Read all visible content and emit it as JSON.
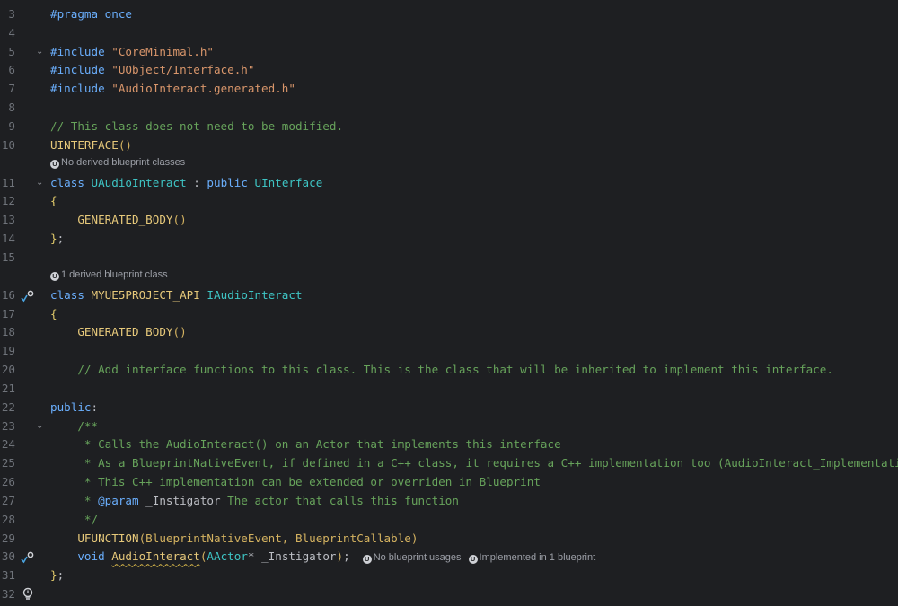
{
  "editor": {
    "lines": [
      {
        "n": "3",
        "segs": [
          {
            "t": "#pragma once",
            "c": "pp"
          }
        ]
      },
      {
        "n": "4",
        "segs": []
      },
      {
        "n": "5",
        "fold": "⌄",
        "segs": [
          {
            "t": "#include ",
            "c": "pp"
          },
          {
            "t": "\"CoreMinimal.h\"",
            "c": "str"
          }
        ]
      },
      {
        "n": "6",
        "segs": [
          {
            "t": "#include ",
            "c": "pp"
          },
          {
            "t": "\"UObject/Interface.h\"",
            "c": "str"
          }
        ]
      },
      {
        "n": "7",
        "segs": [
          {
            "t": "#include ",
            "c": "pp"
          },
          {
            "t": "\"AudioInteract.generated.h\"",
            "c": "str"
          }
        ]
      },
      {
        "n": "8",
        "segs": []
      },
      {
        "n": "9",
        "segs": [
          {
            "t": "// This class does not need to be modified.",
            "c": "cm"
          }
        ]
      },
      {
        "n": "10",
        "segs": [
          {
            "t": "UINTERFACE",
            "c": "mac"
          },
          {
            "t": "()",
            "c": "par"
          }
        ]
      },
      {
        "n": "11",
        "fold": "⌄",
        "segs": [
          {
            "t": "class ",
            "c": "kw"
          },
          {
            "t": "UAudioInteract",
            "c": "cls"
          },
          {
            "t": " : ",
            "c": "plain"
          },
          {
            "t": "public ",
            "c": "kw"
          },
          {
            "t": "UInterface",
            "c": "cls"
          }
        ]
      },
      {
        "n": "12",
        "segs": [
          {
            "t": "{",
            "c": "brace"
          }
        ]
      },
      {
        "n": "13",
        "segs": [
          {
            "t": "    GENERATED_BODY",
            "c": "mac"
          },
          {
            "t": "()",
            "c": "par"
          }
        ]
      },
      {
        "n": "14",
        "segs": [
          {
            "t": "}",
            "c": "brace"
          },
          {
            "t": ";",
            "c": "plain"
          }
        ]
      },
      {
        "n": "15",
        "segs": []
      },
      {
        "n": "16",
        "gutter": "impl",
        "segs": [
          {
            "t": "class ",
            "c": "kw"
          },
          {
            "t": "MYUE5PROJECT_API ",
            "c": "mac"
          },
          {
            "t": "IAudioInteract",
            "c": "cls"
          }
        ]
      },
      {
        "n": "17",
        "segs": [
          {
            "t": "{",
            "c": "brace"
          }
        ]
      },
      {
        "n": "18",
        "segs": [
          {
            "t": "    GENERATED_BODY",
            "c": "mac"
          },
          {
            "t": "()",
            "c": "par"
          }
        ]
      },
      {
        "n": "19",
        "segs": []
      },
      {
        "n": "20",
        "segs": [
          {
            "t": "    // Add interface functions to this class. This is the class that will be inherited to implement this interface.",
            "c": "cm"
          }
        ]
      },
      {
        "n": "21",
        "segs": []
      },
      {
        "n": "22",
        "segs": [
          {
            "t": "public",
            "c": "kw"
          },
          {
            "t": ":",
            "c": "plain"
          }
        ]
      },
      {
        "n": "23",
        "fold": "⌄",
        "segs": [
          {
            "t": "    /**",
            "c": "cm"
          }
        ]
      },
      {
        "n": "24",
        "segs": [
          {
            "t": "     * Calls the AudioInteract() on an Actor that implements this interface",
            "c": "cm"
          }
        ]
      },
      {
        "n": "25",
        "segs": [
          {
            "t": "     * As a BlueprintNativeEvent, if defined in a C++ class, it requires a C++ implementation too (AudioInteract_Implementation)",
            "c": "cm"
          }
        ]
      },
      {
        "n": "26",
        "segs": [
          {
            "t": "     * This C++ implementation can be extended or overriden in Blueprint",
            "c": "cm"
          }
        ]
      },
      {
        "n": "27",
        "segs": [
          {
            "t": "     * ",
            "c": "cm"
          },
          {
            "t": "@param",
            "c": "tag"
          },
          {
            "t": " _Instigator",
            "c": "plain"
          },
          {
            "t": " The actor that calls this function",
            "c": "cm"
          }
        ]
      },
      {
        "n": "28",
        "segs": [
          {
            "t": "     */",
            "c": "cm"
          }
        ]
      },
      {
        "n": "29",
        "segs": [
          {
            "t": "    UFUNCTION",
            "c": "mac"
          },
          {
            "t": "(BlueprintNativeEvent, BlueprintCallable)",
            "c": "par"
          }
        ]
      },
      {
        "n": "30",
        "gutter": "impl",
        "segs": [
          {
            "t": "    void ",
            "c": "kw"
          },
          {
            "t": "AudioInteract",
            "c": "mac",
            "wavy": true
          },
          {
            "t": "(",
            "c": "par"
          },
          {
            "t": "AActor",
            "c": "cls"
          },
          {
            "t": "* ",
            "c": "plain"
          },
          {
            "t": "_Instigator",
            "c": "plain",
            "mark": true
          },
          {
            "t": ")",
            "c": "par"
          },
          {
            "t": ";",
            "c": "plain"
          }
        ],
        "inlays": [
          "No blueprint usages",
          "Implemented in 1 blueprint"
        ]
      },
      {
        "n": "31",
        "segs": [
          {
            "t": "}",
            "c": "brace"
          },
          {
            "t": ";",
            "c": "plain"
          }
        ]
      },
      {
        "n": "32",
        "gutter": "bulb",
        "segs": []
      }
    ],
    "hints": [
      {
        "after": "10",
        "text": "No derived blueprint classes"
      },
      {
        "after": "15",
        "text": "1 derived blueprint class"
      }
    ],
    "badge_letter": "U",
    "colors": {
      "background": "#1e1f22",
      "keyword": "#6aaefc",
      "string": "#d9966b",
      "comment": "#67a35b",
      "macro": "#e6c87a",
      "class": "#3ec4c4"
    }
  }
}
